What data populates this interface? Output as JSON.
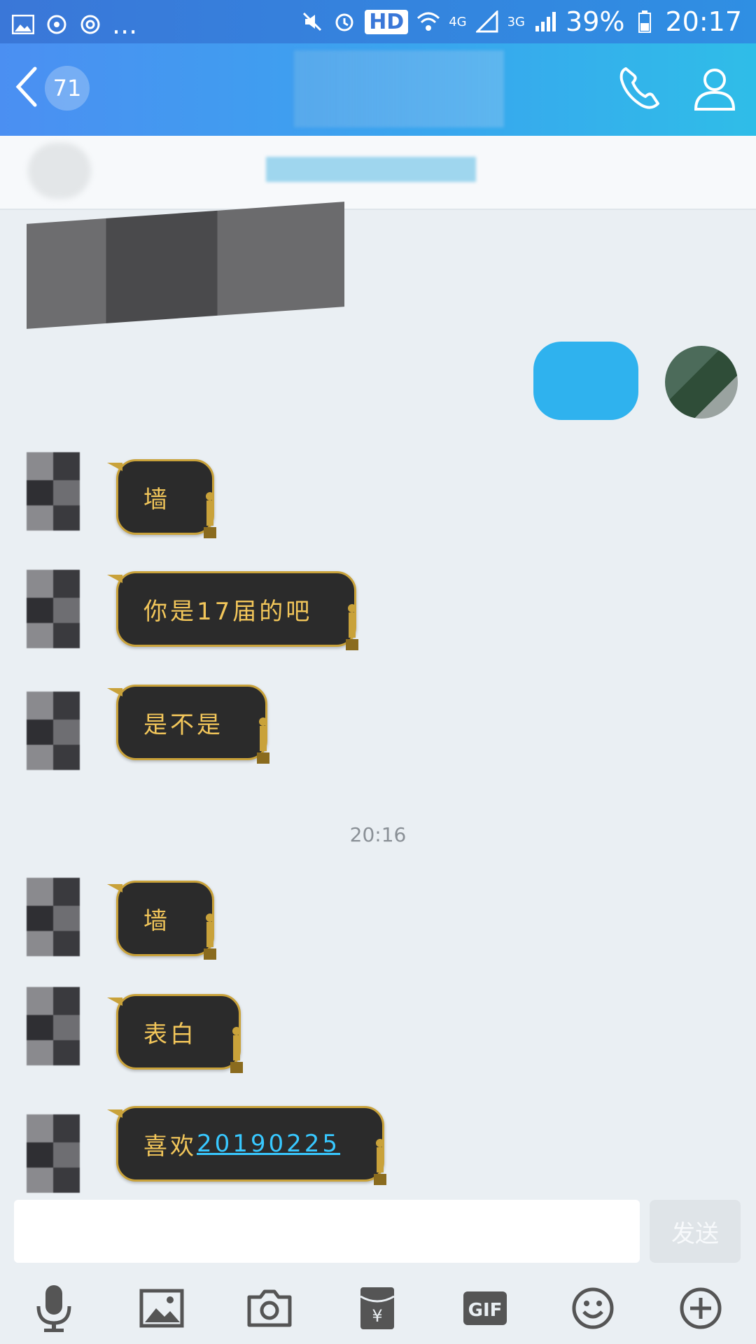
{
  "status_bar": {
    "dots": "...",
    "hd": "HD",
    "net_4g": "4G",
    "net_3g": "3G",
    "battery": "39%",
    "time": "20:17"
  },
  "header": {
    "unread_count": "71"
  },
  "messages": [
    {
      "id": "m1",
      "text": "墙"
    },
    {
      "id": "m2",
      "text": "你是17届的吧"
    },
    {
      "id": "m3",
      "text": "是不是"
    },
    {
      "id": "m4",
      "text": "墙"
    },
    {
      "id": "m5",
      "text": "表白"
    },
    {
      "id": "m6",
      "text_prefix": "喜欢",
      "link": "20190225"
    }
  ],
  "timestamp": "20:16",
  "composer": {
    "value": "",
    "send_label": "发送"
  },
  "toolbar": {
    "gif_label": "GIF",
    "items": [
      "microphone-icon",
      "image-icon",
      "camera-icon",
      "red-packet-icon",
      "gif-icon",
      "emoji-icon",
      "plus-icon"
    ]
  },
  "colors": {
    "header_start": "#4b8ff2",
    "header_end": "#2fbde8",
    "bubble_bg": "#2b2b2b",
    "bubble_border": "#c9a23a",
    "bubble_text": "#f2c65a",
    "link": "#38c8ff",
    "chat_bg": "#eaeff3"
  }
}
